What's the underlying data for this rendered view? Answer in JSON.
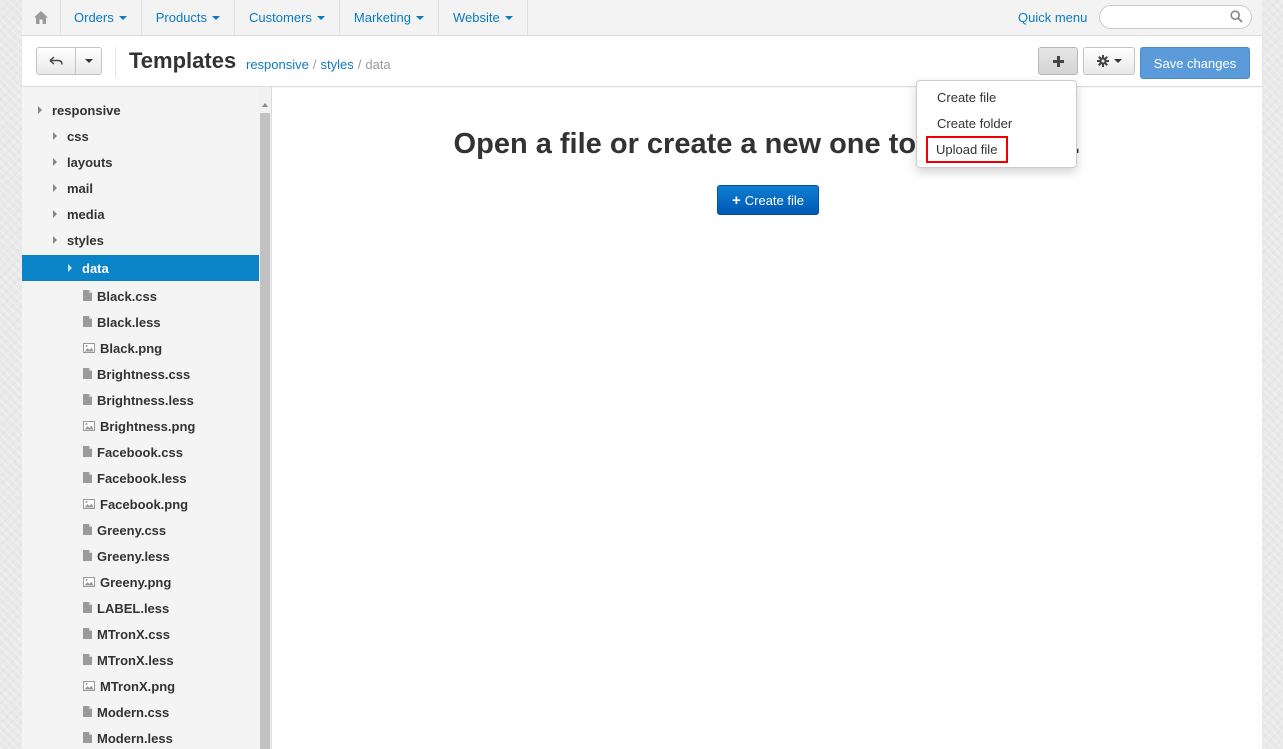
{
  "nav": {
    "items": [
      {
        "label": "Orders"
      },
      {
        "label": "Products"
      },
      {
        "label": "Customers"
      },
      {
        "label": "Marketing"
      },
      {
        "label": "Website"
      }
    ],
    "quick_menu": "Quick menu",
    "search_value": ""
  },
  "header": {
    "title": "Templates",
    "breadcrumb": [
      "responsive",
      "styles",
      "data"
    ],
    "save_label": "Save changes"
  },
  "dropdown": {
    "items": [
      "Create file",
      "Create folder",
      "Upload file"
    ]
  },
  "main": {
    "message": "Open a file or create a new one to get started.",
    "create_label": "Create file"
  },
  "tree": {
    "items": [
      {
        "label": "responsive",
        "type": "folder",
        "level": 0
      },
      {
        "label": "css",
        "type": "folder",
        "level": 1
      },
      {
        "label": "layouts",
        "type": "folder",
        "level": 1
      },
      {
        "label": "mail",
        "type": "folder",
        "level": 1
      },
      {
        "label": "media",
        "type": "folder",
        "level": 1
      },
      {
        "label": "styles",
        "type": "folder",
        "level": 1
      },
      {
        "label": "data",
        "type": "folder",
        "level": 2,
        "selected": true
      },
      {
        "label": "Black.css",
        "type": "file",
        "level": 3
      },
      {
        "label": "Black.less",
        "type": "file",
        "level": 3
      },
      {
        "label": "Black.png",
        "type": "image",
        "level": 3
      },
      {
        "label": "Brightness.css",
        "type": "file",
        "level": 3
      },
      {
        "label": "Brightness.less",
        "type": "file",
        "level": 3
      },
      {
        "label": "Brightness.png",
        "type": "image",
        "level": 3
      },
      {
        "label": "Facebook.css",
        "type": "file",
        "level": 3
      },
      {
        "label": "Facebook.less",
        "type": "file",
        "level": 3
      },
      {
        "label": "Facebook.png",
        "type": "image",
        "level": 3
      },
      {
        "label": "Greeny.css",
        "type": "file",
        "level": 3
      },
      {
        "label": "Greeny.less",
        "type": "file",
        "level": 3
      },
      {
        "label": "Greeny.png",
        "type": "image",
        "level": 3
      },
      {
        "label": "LABEL.less",
        "type": "file",
        "level": 3
      },
      {
        "label": "MTronX.css",
        "type": "file",
        "level": 3
      },
      {
        "label": "MTronX.less",
        "type": "file",
        "level": 3
      },
      {
        "label": "MTronX.png",
        "type": "image",
        "level": 3
      },
      {
        "label": "Modern.css",
        "type": "file",
        "level": 3
      },
      {
        "label": "Modern.less",
        "type": "file",
        "level": 3
      }
    ]
  },
  "colors": {
    "link": "#0a7bc1",
    "selected": "#0a84c7",
    "save": "#5b9bd9",
    "create": "#0068c3",
    "highlight_outline": "#e00000"
  }
}
